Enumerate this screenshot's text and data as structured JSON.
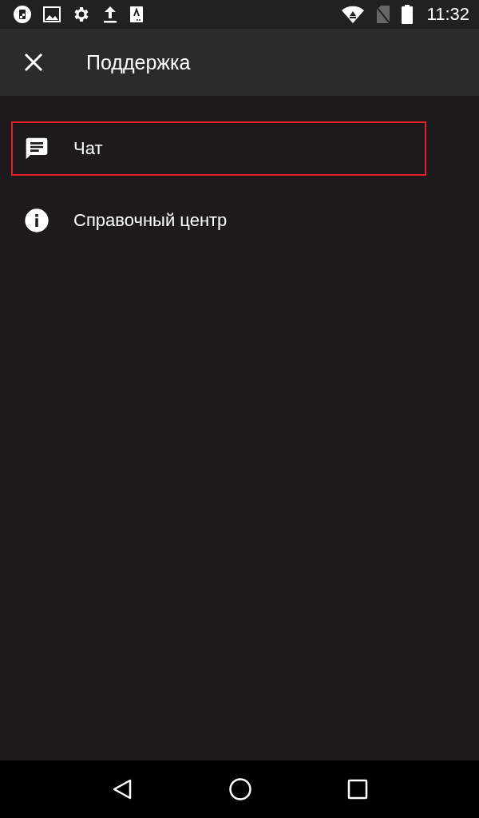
{
  "status_bar": {
    "time": "11:32"
  },
  "app_bar": {
    "title": "Поддержка"
  },
  "menu": [
    {
      "kind": "chat",
      "label": "Чат",
      "highlighted": true
    },
    {
      "kind": "info",
      "label": "Справочный центр",
      "highlighted": false
    }
  ]
}
